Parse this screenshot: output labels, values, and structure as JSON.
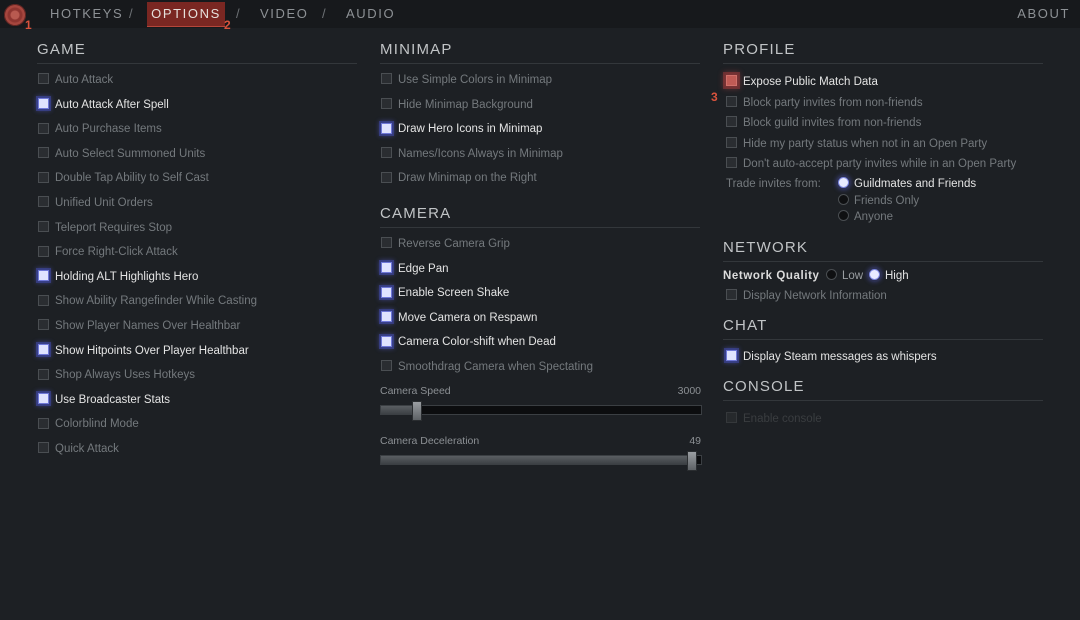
{
  "markers": [
    "1",
    "2",
    "3"
  ],
  "nav": {
    "items": [
      "HOTKEYS",
      "OPTIONS",
      "VIDEO",
      "AUDIO"
    ],
    "separator": "/",
    "active": "OPTIONS",
    "about": "ABOUT"
  },
  "game": {
    "title": "GAME",
    "options": [
      {
        "label": "Auto Attack",
        "checked": false
      },
      {
        "label": "Auto Attack After Spell",
        "checked": true
      },
      {
        "label": "Auto Purchase Items",
        "checked": false
      },
      {
        "label": "Auto Select Summoned Units",
        "checked": false
      },
      {
        "label": "Double Tap Ability to Self Cast",
        "checked": false
      },
      {
        "label": "Unified Unit Orders",
        "checked": false
      },
      {
        "label": "Teleport Requires Stop",
        "checked": false
      },
      {
        "label": "Force Right-Click Attack",
        "checked": false
      },
      {
        "label": "Holding ALT Highlights Hero",
        "checked": true
      },
      {
        "label": "Show Ability Rangefinder While Casting",
        "checked": false
      },
      {
        "label": "Show Player Names Over Healthbar",
        "checked": false
      },
      {
        "label": "Show Hitpoints Over Player Healthbar",
        "checked": true
      },
      {
        "label": "Shop Always Uses Hotkeys",
        "checked": false
      },
      {
        "label": "Use Broadcaster Stats",
        "checked": true
      },
      {
        "label": "Colorblind Mode",
        "checked": false
      },
      {
        "label": "Quick Attack",
        "checked": false
      }
    ]
  },
  "minimap": {
    "title": "MINIMAP",
    "options": [
      {
        "label": "Use Simple Colors in Minimap",
        "checked": false
      },
      {
        "label": "Hide Minimap Background",
        "checked": false
      },
      {
        "label": "Draw Hero Icons in Minimap",
        "checked": true
      },
      {
        "label": "Names/Icons Always in Minimap",
        "checked": false
      },
      {
        "label": "Draw Minimap on the Right",
        "checked": false
      }
    ]
  },
  "camera": {
    "title": "CAMERA",
    "options": [
      {
        "label": "Reverse Camera Grip",
        "checked": false
      },
      {
        "label": "Edge Pan",
        "checked": true
      },
      {
        "label": "Enable Screen Shake",
        "checked": true
      },
      {
        "label": "Move Camera on Respawn",
        "checked": true
      },
      {
        "label": "Camera Color-shift when Dead",
        "checked": true
      },
      {
        "label": "Smoothdrag Camera when Spectating",
        "checked": false
      }
    ],
    "speed": {
      "label": "Camera Speed",
      "value": "3000",
      "fraction": 0.1
    },
    "deceleration": {
      "label": "Camera Deceleration",
      "value": "49",
      "fraction": 0.98
    }
  },
  "profile": {
    "title": "PROFILE",
    "options": [
      {
        "label": "Expose Public Match Data",
        "checked": true,
        "highlight": "red"
      },
      {
        "label": "Block party invites from non-friends",
        "checked": false
      },
      {
        "label": "Block guild invites from non-friends",
        "checked": false
      },
      {
        "label": "Hide my party status when not in an Open Party",
        "checked": false
      },
      {
        "label": "Don't auto-accept party invites while in an Open Party",
        "checked": false
      }
    ],
    "trade_label": "Trade invites from:",
    "trade_options": [
      {
        "label": "Guildmates and Friends",
        "selected": true
      },
      {
        "label": "Friends Only",
        "selected": false
      },
      {
        "label": "Anyone",
        "selected": false
      }
    ]
  },
  "network": {
    "title": "NETWORK",
    "quality_label": "Network Quality",
    "quality_options": [
      {
        "label": "Low",
        "selected": false
      },
      {
        "label": "High",
        "selected": true
      }
    ],
    "display_info": {
      "label": "Display Network Information",
      "checked": false
    }
  },
  "chat": {
    "title": "CHAT",
    "options": [
      {
        "label": "Display Steam messages as whispers",
        "checked": true
      }
    ]
  },
  "console": {
    "title": "CONSOLE",
    "options": [
      {
        "label": "Enable console",
        "checked": false,
        "disabled": true
      }
    ]
  },
  "colors": {
    "background": "#1d2024",
    "active_tab": "#7a2722",
    "marker": "#d9533d",
    "checked_glow": "#5a64dc"
  }
}
